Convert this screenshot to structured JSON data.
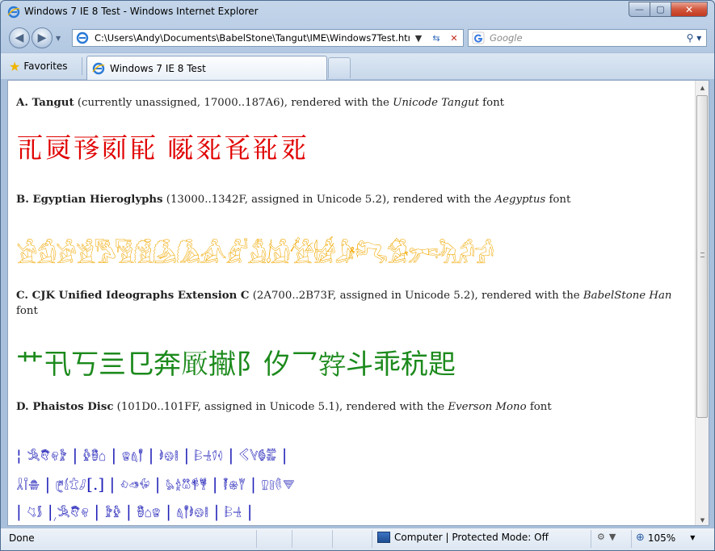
{
  "window": {
    "title": "Windows 7 IE 8 Test - Windows Internet Explorer",
    "controls": {
      "minimize": "—",
      "maximize": "▢",
      "close": "✕"
    }
  },
  "address": {
    "url": "C:\\Users\\Andy\\Documents\\BabelStone\\Tangut\\IME\\Windows7Test.html",
    "search_placeholder": "Google"
  },
  "favorites": {
    "label": "Favorites"
  },
  "tab": {
    "label": "Windows 7 IE 8 Test"
  },
  "content": {
    "sections": [
      {
        "title": "A. Tangut",
        "desc_before": " (currently unassigned, 17000..187A6), rendered with the ",
        "font": "Unicode Tangut",
        "desc_after": " font",
        "glyphs": "𗀀𗀁𗀂𗀃𗀄 𗀅𗀆𗀇𗀈𗀉"
      },
      {
        "title": "B. Egyptian Hieroglyphs",
        "desc_before": " (13000..1342F, assigned in Unicode 5.2), rendered with the ",
        "font": "Aegyptus",
        "desc_after": " font",
        "glyphs": "𓀀𓀁𓀂𓀃𓀄𓀅𓀆𓀇𓀈𓀉𓀊𓀋𓀌𓀍𓀎𓀏𓀐𓀑𓀒𓀓𓀔𓀕"
      },
      {
        "title": "C. CJK Unified Ideographs Extension C",
        "desc_before": " (2A700..2B73F, assigned in Unicode 5.2), rendered with the ",
        "font": "BabelStone Han",
        "desc_after": " font",
        "glyphs": "艹卂丂亖㔾奔𠪚擜阝㐴乛𡦂斗乖秔𢁈"
      },
      {
        "title": "D. Phaistos Disc",
        "desc_before": " (101D0..101FF, assigned in Unicode 5.1), rendered with the ",
        "font": "Everson Mono",
        "desc_after": " font",
        "lines": [
          "¦ 𐇐𐇑𐇒𐇓 | 𐇔𐇕𐇖 | 𐇗𐇘𐇙 | 𐇚𐇛𐇜 | 𐇝𐇞𐇟𐇠 | 𐇡𐇢𐇣𐇤 |",
          "𐇥𐇦𐇧 | 𐇨𐇩𐇪𐇫[.] | 𐇬𐇭𐇮 | 𐇯𐇰𐇱𐇲𐇳 | 𐇴𐇵𐇶 | 𐇷𐇸𐇹𐇺",
          "| 𐇻𐇼 | 𐇽𐇐𐇑𐇒 | 𐇓𐇔 | 𐇕𐇖𐇗 | 𐇘𐇙𐇚𐇛𐇜 | 𐇝𐇞 |"
        ]
      }
    ]
  },
  "status": {
    "left": "Done",
    "zone": "Computer | Protected Mode: Off",
    "zoom": "105%"
  },
  "colors": {
    "tangut": "#e00000",
    "egyptian": "#f0a800",
    "cjk": "#1c8a1c",
    "phaistos": "#1f1fb8"
  }
}
